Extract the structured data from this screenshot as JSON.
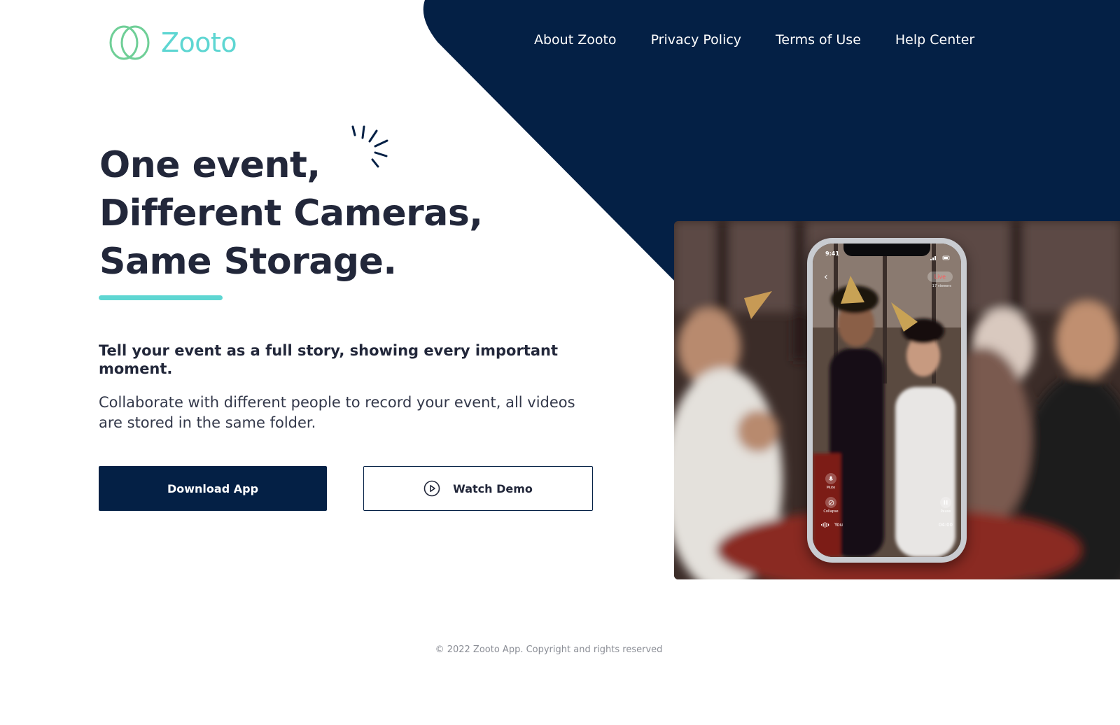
{
  "brand": {
    "name": "Zooto",
    "accent_color": "#5ed6d2",
    "logo_ring_color": "#6fcf97",
    "dark_navy": "#042045",
    "icon": "logo-rings-icon"
  },
  "nav": {
    "items": [
      {
        "label": "About Zooto"
      },
      {
        "label": "Privacy Policy"
      },
      {
        "label": "Terms of Use"
      },
      {
        "label": "Help Center"
      }
    ]
  },
  "hero": {
    "headline": [
      "One event,",
      "Different Cameras,",
      "Same Storage."
    ],
    "lead": "Tell your event as a full story, showing every important moment.",
    "description": "Collaborate with different people to record your event, all videos are stored in the same folder.",
    "buttons": {
      "download_label": "Download App",
      "demo_label": "Watch Demo",
      "demo_icon": "play-circle-icon"
    }
  },
  "phone": {
    "time": "9:41",
    "live_label": "Live",
    "viewers": "17 viewers",
    "controls": [
      {
        "label": "Mute",
        "icon": "microphone-icon"
      },
      {
        "label": "Collapse",
        "icon": "collapse-icon"
      },
      {
        "label": "Pause",
        "icon": "pause-icon"
      }
    ],
    "you_label": "You",
    "timer": "04:00"
  },
  "footer": {
    "copyright": "© 2022 Zooto App. Copyright and rights reserved"
  }
}
